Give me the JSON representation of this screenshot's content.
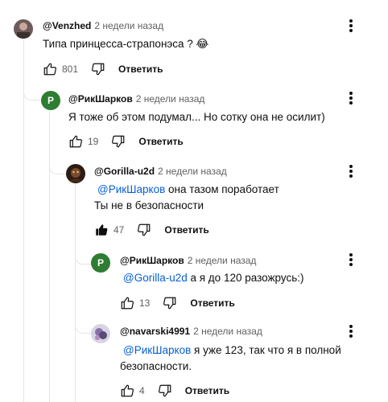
{
  "comments": [
    {
      "author": "@Venzhed",
      "time": "2 недели назад",
      "text": "Типа принцесса-страпонэса ? 😂",
      "likes": "801",
      "reply_label": "Ответить",
      "avatar_icon": "user-avatar-photo"
    },
    {
      "author": "@РикШарков",
      "time": "2 недели назад",
      "text": "Я тоже об этом подумал... Но сотку она не осилит)",
      "likes": "19",
      "reply_label": "Ответить",
      "avatar_letter": "Р",
      "avatar_color": "#2e7d32"
    },
    {
      "author": "@Gorilla-u2d",
      "time": "2 недели назад",
      "mention": "@РикШарков",
      "text": " она тазом поработает",
      "text2": "Ты не в безопасности",
      "likes": "47",
      "reply_label": "Ответить",
      "liked": true,
      "avatar_icon": "user-avatar-photo"
    },
    {
      "author": "@РикШарков",
      "time": "2 недели назад",
      "mention": "@Gorilla-u2d",
      "text": " а я до 120 разожрусь:)",
      "likes": "13",
      "reply_label": "Ответить",
      "avatar_letter": "Р",
      "avatar_color": "#2e7d32"
    },
    {
      "author": "@navarski4991",
      "time": "2 недели назад",
      "mention": "@РикШарков",
      "text": " я уже 123, так что я в полной",
      "text2": "безопасности.",
      "likes": "4",
      "reply_label": "Ответить",
      "avatar_icon": "user-avatar-photo"
    }
  ],
  "colors": {
    "mention": "#065fd4",
    "secondary_text": "#606060",
    "thread_line": "#e5e5e5"
  }
}
